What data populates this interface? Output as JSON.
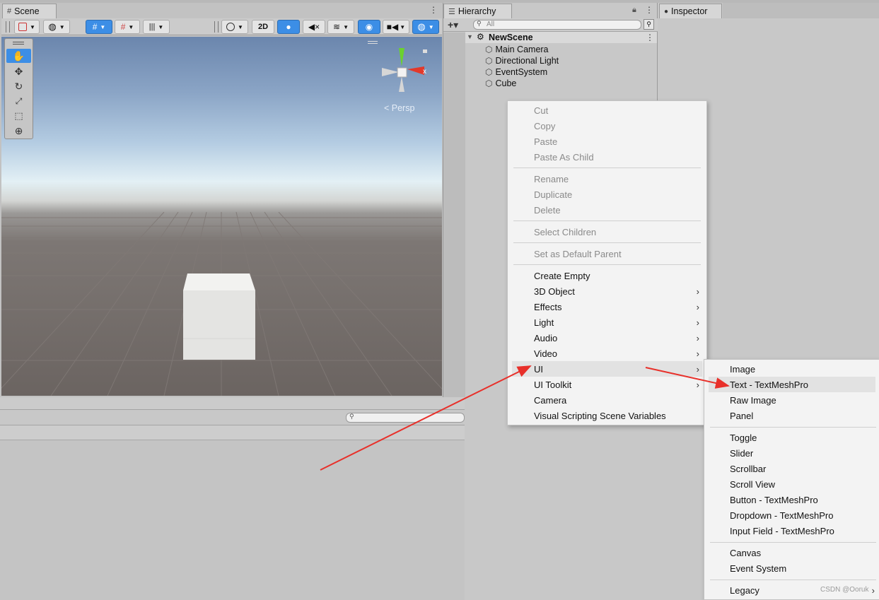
{
  "scene_tab": {
    "title": "Scene"
  },
  "scene_toolbar": {
    "mode_2d": "2D",
    "persp_label": "< Persp",
    "gizmo_x_label": "x"
  },
  "hierarchy": {
    "title": "Hierarchy",
    "add_label": "+▾",
    "search_placeholder": "All",
    "scene_name": "NewScene",
    "items": [
      "Main Camera",
      "Directional Light",
      "EventSystem",
      "Cube"
    ]
  },
  "inspector": {
    "title": "Inspector"
  },
  "context_menu": {
    "groups": [
      [
        {
          "label": "Cut",
          "disabled": true
        },
        {
          "label": "Copy",
          "disabled": true
        },
        {
          "label": "Paste",
          "disabled": true
        },
        {
          "label": "Paste As Child",
          "disabled": true
        }
      ],
      [
        {
          "label": "Rename",
          "disabled": true
        },
        {
          "label": "Duplicate",
          "disabled": true
        },
        {
          "label": "Delete",
          "disabled": true
        }
      ],
      [
        {
          "label": "Select Children",
          "disabled": true
        }
      ],
      [
        {
          "label": "Set as Default Parent",
          "disabled": true
        }
      ],
      [
        {
          "label": "Create Empty"
        },
        {
          "label": "3D Object",
          "submenu": true
        },
        {
          "label": "Effects",
          "submenu": true
        },
        {
          "label": "Light",
          "submenu": true
        },
        {
          "label": "Audio",
          "submenu": true
        },
        {
          "label": "Video",
          "submenu": true
        },
        {
          "label": "UI",
          "submenu": true,
          "highlighted": true
        },
        {
          "label": "UI Toolkit",
          "submenu": true
        },
        {
          "label": "Camera"
        },
        {
          "label": "Visual Scripting Scene Variables"
        }
      ]
    ]
  },
  "ui_submenu": {
    "groups": [
      [
        {
          "label": "Image"
        },
        {
          "label": "Text - TextMeshPro",
          "highlighted": true
        },
        {
          "label": "Raw Image"
        },
        {
          "label": "Panel"
        }
      ],
      [
        {
          "label": "Toggle"
        },
        {
          "label": "Slider"
        },
        {
          "label": "Scrollbar"
        },
        {
          "label": "Scroll View"
        },
        {
          "label": "Button - TextMeshPro"
        },
        {
          "label": "Dropdown - TextMeshPro"
        },
        {
          "label": "Input Field - TextMeshPro"
        }
      ],
      [
        {
          "label": "Canvas"
        },
        {
          "label": "Event System"
        }
      ],
      [
        {
          "label": "Legacy",
          "submenu": true
        }
      ]
    ]
  },
  "watermark": "CSDN @Ooruk",
  "colors": {
    "accent_blue": "#3c8ee6",
    "arrow_red": "#e8302a",
    "menu_bg": "#f3f3f3",
    "highlight": "#e2e2e2"
  }
}
